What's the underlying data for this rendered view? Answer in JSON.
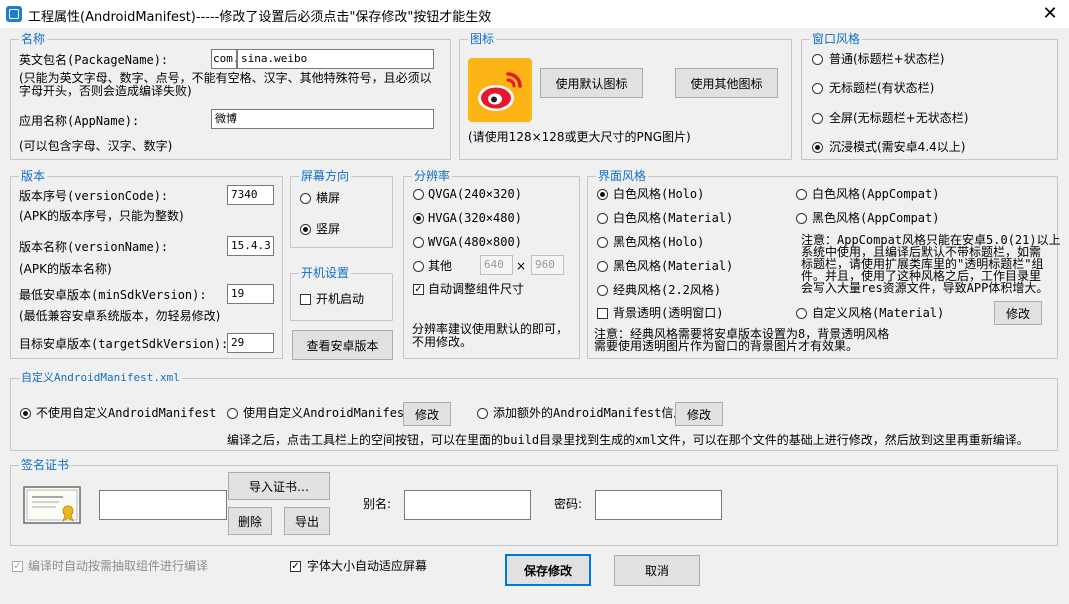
{
  "window": {
    "title": "工程属性(AndroidManifest)-----修改了设置后必须点击\"保存修改\"按钮才能生效",
    "close_glyph": "✕"
  },
  "name_group": {
    "legend": "名称",
    "package_label": "英文包名(PackageName):",
    "package_prefix": "com.",
    "package_value": "sina.weibo",
    "package_hint_1": "(只能为英文字母、数字、点号，不能有空格、汉字、其他特殊符号，且必须以",
    "package_hint_2": "字母开头，否则会造成编译失败)",
    "app_label": "应用名称(AppName):",
    "app_value": "微博",
    "app_hint": "(可以包含字母、汉字、数字)"
  },
  "icon_group": {
    "legend": "图标",
    "default_btn": "使用默认图标",
    "other_btn": "使用其他图标",
    "hint": "(请使用128×128或更大尺寸的PNG图片)",
    "color_bg": "#fdb515",
    "color_weibo": "#e6162d"
  },
  "window_style": {
    "legend": "窗口风格",
    "options": [
      "普通(标题栏+状态栏)",
      "无标题栏(有状态栏)",
      "全屏(无标题栏+无状态栏)",
      "沉浸模式(需安卓4.4以上)"
    ],
    "selected": 3
  },
  "version_group": {
    "legend": "版本",
    "code_label": "版本序号(versionCode):",
    "code_value": "7340",
    "code_hint": "(APK的版本序号，只能为整数)",
    "name_label": "版本名称(versionName):",
    "name_value": "15.4.3",
    "name_hint": "(APK的版本名称)",
    "min_label": "最低安卓版本(minSdkVersion):",
    "min_value": "19",
    "min_hint": "(最低兼容安卓系统版本，勿轻易修改)",
    "target_label": "目标安卓版本(targetSdkVersion):",
    "target_value": "29"
  },
  "orientation": {
    "legend": "屏幕方向",
    "options": [
      "横屏",
      "竖屏"
    ],
    "selected": 1
  },
  "boot": {
    "legend": "开机设置",
    "check_label": "开机启动",
    "checked": false
  },
  "view_android_btn": "查看安卓版本",
  "resolution": {
    "legend": "分辨率",
    "options": [
      "QVGA(240×320)",
      "HVGA(320×480)",
      "WVGA(480×800)",
      "其他"
    ],
    "selected": 1,
    "other_w": "640",
    "times": "×",
    "other_h": "960",
    "auto_label": "自动调整组件尺寸",
    "auto_checked": true,
    "hint_1": "分辨率建议使用默认的即可，",
    "hint_2": "不用修改。"
  },
  "ui_style": {
    "legend": "界面风格",
    "left": [
      "白色风格(Holo)",
      "白色风格(Material)",
      "黑色风格(Holo)",
      "黑色风格(Material)",
      "经典风格(2.2风格)"
    ],
    "right": [
      "白色风格(AppCompat)",
      "黑色风格(AppCompat)"
    ],
    "selected_left": 0,
    "note_lines": [
      "注意：AppCompat风格只能在安卓5.0(21)以上",
      "系统中使用，且编译后默认不带标题栏，如需",
      "标题栏，请使用扩展类库里的\"透明标题栏\"组",
      "件。并且，使用了这种风格之后，工作目录里",
      "会写入大量res资源文件，导致APP体积增大。"
    ],
    "bg_transparent": "背景透明(透明窗口)",
    "custom": "自定义风格(Material)",
    "modify_btn": "修改",
    "bottom_note_1": "注意：经典风格需要将安卓版本设置为8，背景透明风格",
    "bottom_note_2": "需要使用透明图片作为窗口的背景图片才有效果。"
  },
  "custom_manifest": {
    "legend": "自定义AndroidManifest.xml",
    "opt1": "不使用自定义AndroidManifest",
    "opt2": "使用自定义AndroidManifest",
    "opt3": "添加额外的AndroidManifest信息",
    "modify": "修改",
    "selected": 0,
    "hint": "编译之后，点击工具栏上的空间按钮，可以在里面的build目录里找到生成的xml文件，可以在那个文件的基础上进行修改，然后放到这里再重新编译。"
  },
  "signature": {
    "legend": "签名证书",
    "import_btn": "导入证书…",
    "delete_btn": "删除",
    "export_btn": "导出",
    "alias_label": "别名:",
    "password_label": "密码:",
    "cert_value": "",
    "alias_value": "",
    "password_value": ""
  },
  "footer": {
    "auto_extract": "编译时自动按需抽取组件进行编译",
    "font_auto": "字体大小自动适应屏幕",
    "save_btn": "保存修改",
    "cancel_btn": "取消",
    "font_checked": true
  }
}
